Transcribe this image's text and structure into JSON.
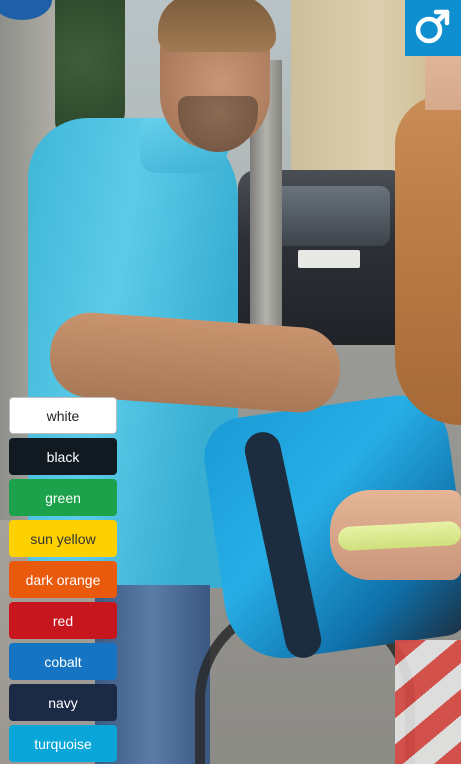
{
  "badge": {
    "icon": "male-symbol-icon",
    "color": "#0f8fcf"
  },
  "colors": [
    {
      "label": "white",
      "hex": "#ffffff",
      "text": "#222222"
    },
    {
      "label": "black",
      "hex": "#111a20",
      "text": "#ffffff"
    },
    {
      "label": "green",
      "hex": "#1ca24a",
      "text": "#ffffff"
    },
    {
      "label": "sun yellow",
      "hex": "#fdd100",
      "text": "#333333"
    },
    {
      "label": "dark orange",
      "hex": "#ea5a0d",
      "text": "#ffffff"
    },
    {
      "label": "red",
      "hex": "#c8161f",
      "text": "#ffffff"
    },
    {
      "label": "cobalt",
      "hex": "#1575c2",
      "text": "#ffffff"
    },
    {
      "label": "navy",
      "hex": "#1b2b45",
      "text": "#ffffff"
    },
    {
      "label": "turquoise",
      "hex": "#0aa6d9",
      "text": "#ffffff"
    }
  ]
}
